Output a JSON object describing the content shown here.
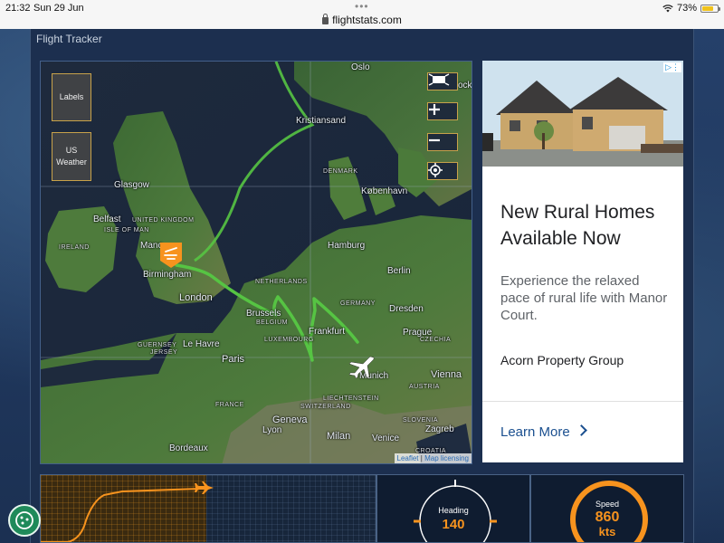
{
  "status_bar": {
    "time": "21:32",
    "date": "Sun 29 Jun",
    "url": "flightstats.com",
    "battery": "73%",
    "battery_level": 0.73,
    "icons": [
      "wifi-icon",
      "battery-icon",
      "lock-icon"
    ]
  },
  "panel": {
    "title": "Flight Tracker"
  },
  "map": {
    "buttons": {
      "labels": "Labels",
      "us_weather_line1": "US",
      "us_weather_line2": "Weather"
    },
    "controls": [
      "fullscreen-icon",
      "zoom-in-icon",
      "zoom-out-icon",
      "locate-icon"
    ],
    "places": {
      "oslo": "Oslo",
      "kristiansand": "Kristiansand",
      "denmark": "DENMARK",
      "kobenhavn": "København",
      "glasgow": "Glasgow",
      "belfast": "Belfast",
      "united_kingdom": "UNITED KINGDOM",
      "isle_of_man": "ISLE OF MAN",
      "ireland": "IRELAND",
      "manchester": "Manc",
      "birmingham": "Birmingham",
      "london": "London",
      "hamburg": "Hamburg",
      "berlin": "Berlin",
      "netherlands": "NETHERLANDS",
      "germany": "GERMANY",
      "dresden": "Dresden",
      "brussels": "Brussels",
      "belgium": "BELGIUM",
      "luxembourg": "LUXEMBOURG",
      "frankfurt": "Frankfurt",
      "prague": "Prague",
      "czechia": "CZECHIA",
      "guernsey": "GUERNSEY",
      "jersey": "JERSEY",
      "le_havre": "Le Havre",
      "paris": "Paris",
      "munich": "Munich",
      "vienna": "Vienna",
      "austria": "AUSTRIA",
      "liechtenstein": "LIECHTENSTEIN",
      "switzerland": "SWITZERLAND",
      "france": "FRANCE",
      "geneva": "Geneva",
      "lyon": "Lyon",
      "slovenia": "SLOVENIA",
      "zagreb": "Zagreb",
      "milan": "Milan",
      "venice": "Venice",
      "bordeaux": "Bordeaux",
      "croatia": "CROATIA",
      "stockholm_partial": "ock"
    },
    "attribution": {
      "leaflet": "Leaflet",
      "separator": "|",
      "licensing": "Map licensing"
    }
  },
  "ad": {
    "choices_icon": "ad-choices-icon",
    "headline": "New Rural Homes Available Now",
    "body": "Experience the relaxed pace of rural life with Manor Court.",
    "advertiser": "Acorn Property Group",
    "cta": "Learn More"
  },
  "instruments": {
    "heading_label": "Heading",
    "heading_value": "140",
    "speed_label": "Speed",
    "speed_value": "860",
    "speed_unit": "kts"
  },
  "colors": {
    "accent_orange": "#f7931e",
    "track_green": "#56c443",
    "ad_cta_blue": "#1a4f8f",
    "fab_green": "#1f8a5a"
  }
}
